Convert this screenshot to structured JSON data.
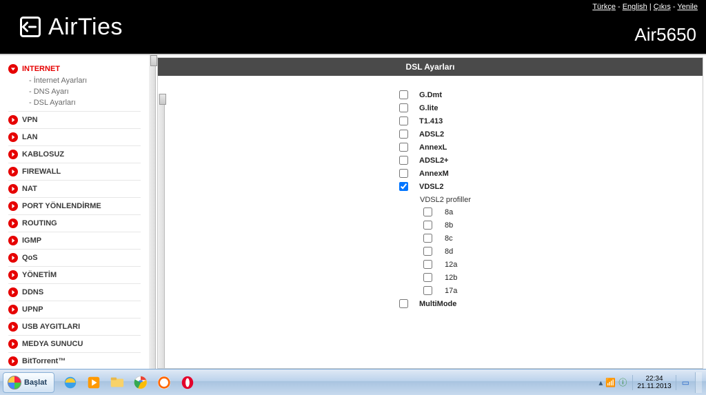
{
  "header": {
    "lang_turkce": "Türkçe",
    "lang_english": "English",
    "link_logout": "Çıkış",
    "link_refresh": "Yenile",
    "sep_dash": " - ",
    "sep_pipe": "  |  ",
    "brand": "AirTies",
    "model": "Air5650"
  },
  "nav": {
    "items": [
      {
        "label": "INTERNET",
        "open": true,
        "sub": [
          "- İnternet Ayarları",
          "- DNS Ayarı",
          "- DSL Ayarları"
        ]
      },
      {
        "label": "VPN"
      },
      {
        "label": "LAN"
      },
      {
        "label": "KABLOSUZ"
      },
      {
        "label": "FIREWALL"
      },
      {
        "label": "NAT"
      },
      {
        "label": "PORT YÖNLENDİRME"
      },
      {
        "label": "ROUTING"
      },
      {
        "label": "IGMP"
      },
      {
        "label": "QoS"
      },
      {
        "label": "YÖNETİM"
      },
      {
        "label": "DDNS"
      },
      {
        "label": "UPNP"
      },
      {
        "label": "USB AYGITLARI"
      },
      {
        "label": "MEDYA SUNUCU"
      },
      {
        "label": "BitTorrent™"
      }
    ]
  },
  "panel": {
    "title": "DSL Ayarları",
    "options": [
      {
        "label": "G.Dmt",
        "checked": false
      },
      {
        "label": "G.lite",
        "checked": false
      },
      {
        "label": "T1.413",
        "checked": false
      },
      {
        "label": "ADSL2",
        "checked": false
      },
      {
        "label": "AnnexL",
        "checked": false
      },
      {
        "label": "ADSL2+",
        "checked": false
      },
      {
        "label": "AnnexM",
        "checked": false
      },
      {
        "label": "VDSL2",
        "checked": true
      }
    ],
    "profiles_header": "VDSL2 profiller",
    "profiles": [
      {
        "label": "8a",
        "checked": false
      },
      {
        "label": "8b",
        "checked": false
      },
      {
        "label": "8c",
        "checked": false
      },
      {
        "label": "8d",
        "checked": false
      },
      {
        "label": "12a",
        "checked": false
      },
      {
        "label": "12b",
        "checked": false
      },
      {
        "label": "17a",
        "checked": false
      }
    ],
    "multimode": {
      "label": "MultiMode",
      "checked": false
    }
  },
  "taskbar": {
    "start": "Başlat",
    "time": "22:34",
    "date": "21.11.2013"
  }
}
